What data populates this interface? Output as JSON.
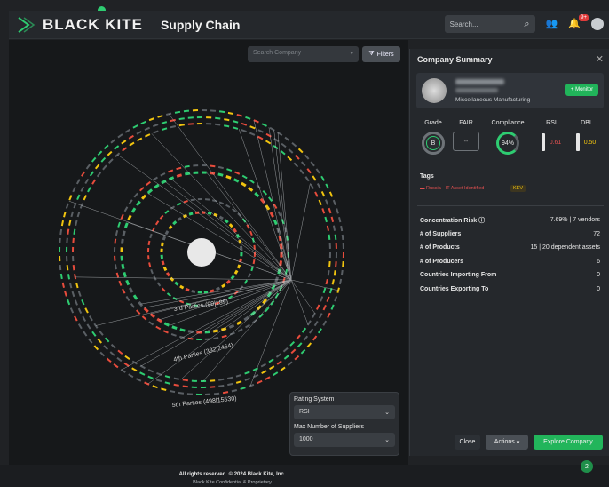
{
  "header": {
    "brand": "BLACK KITE",
    "title": "Supply Chain",
    "search_placeholder": "Search...",
    "notification_count": "9+"
  },
  "canvas": {
    "search_placeholder": "Search Company",
    "filters_label": "Filters",
    "ring_labels": [
      "3rd Parties (99|189)",
      "4th Parties (332|2464)",
      "5th Parties (498|15530)"
    ],
    "rating_system_label": "Rating System",
    "rating_system_value": "RSI",
    "max_suppliers_label": "Max Number of Suppliers",
    "max_suppliers_value": "1000"
  },
  "panel": {
    "title": "Company Summary",
    "industry": "Miscellaneous Manufacturing",
    "monitor_label": "+ Monitor",
    "metrics": [
      {
        "label": "Grade",
        "value": "B"
      },
      {
        "label": "FAIR",
        "value": "--"
      },
      {
        "label": "Compliance",
        "value": "94%"
      },
      {
        "label": "RSI",
        "value": "0.61"
      },
      {
        "label": "DBI",
        "value": "0.50"
      }
    ],
    "tags_label": "Tags",
    "tags": [
      "Russia - IT Asset Identified",
      "KEV"
    ],
    "stats": [
      {
        "label": "Concentration Risk ⓘ",
        "value": "7.69% | 7 vendors"
      },
      {
        "label": "# of Suppliers",
        "value": "72"
      },
      {
        "label": "# of Products",
        "value": "15 | 20 dependent assets"
      },
      {
        "label": "# of Producers",
        "value": "6"
      },
      {
        "label": "Countries Importing From",
        "value": "0"
      },
      {
        "label": "Countries Exporting To",
        "value": "0"
      }
    ],
    "close_label": "Close",
    "actions_label": "Actions",
    "explore_label": "Explore Company"
  },
  "footer": {
    "line1": "All rights reserved. © 2024 Black Kite, Inc.",
    "line2": "Black Kite Confidential & Proprietary"
  },
  "help_badge": "2",
  "colors": {
    "accent": "#2ecc71",
    "danger": "#e05050",
    "warning": "#f1c40f"
  }
}
